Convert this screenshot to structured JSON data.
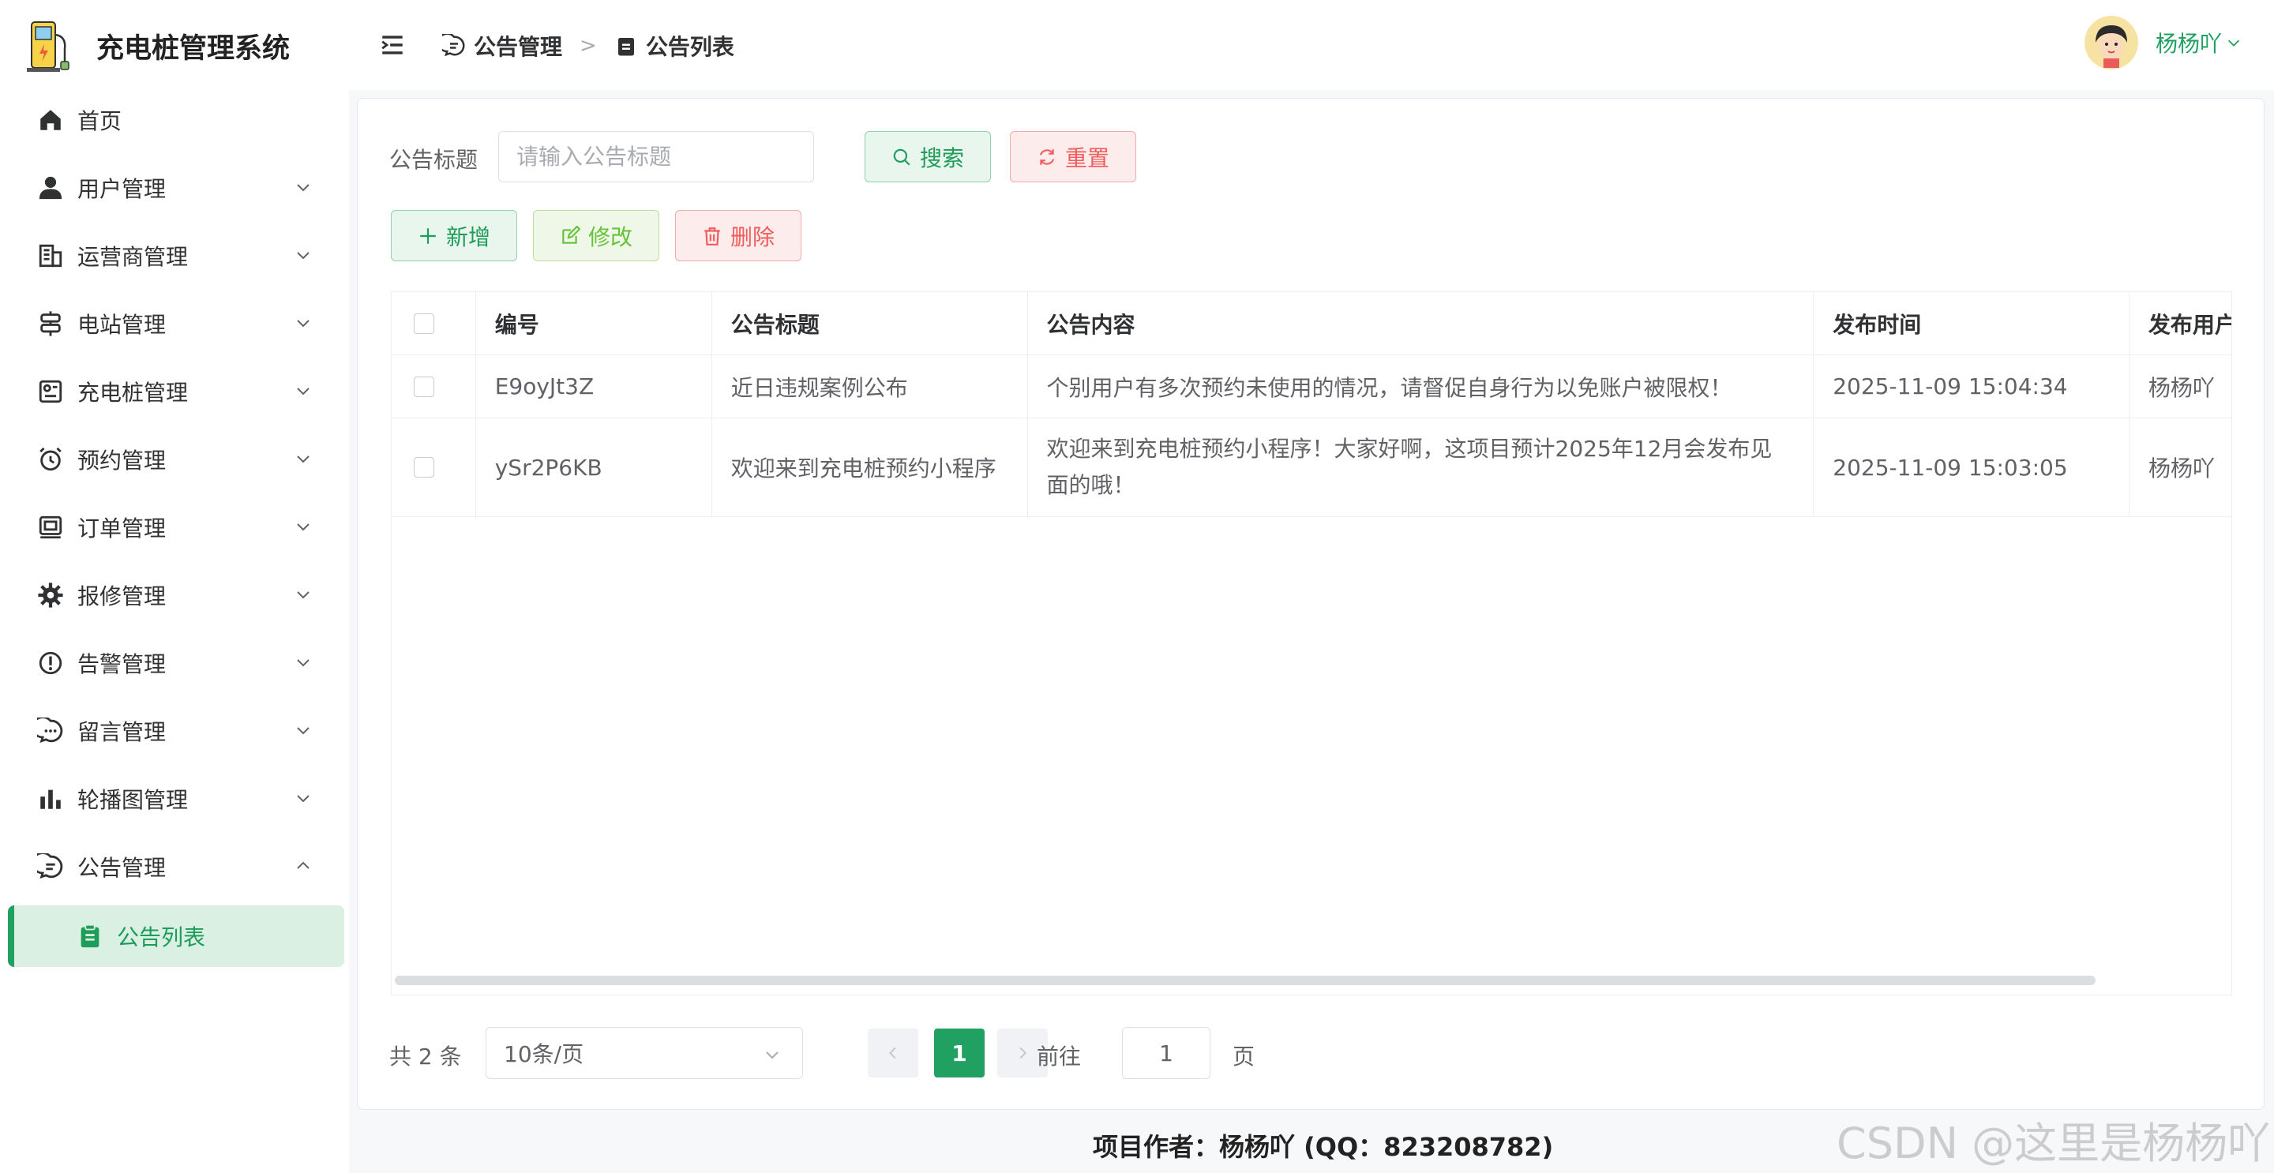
{
  "app": {
    "title": "充电桩管理系统"
  },
  "sidebar": {
    "items": [
      {
        "label": "首页",
        "icon": "home-icon"
      },
      {
        "label": "用户管理",
        "icon": "user-icon"
      },
      {
        "label": "运营商管理",
        "icon": "building-icon"
      },
      {
        "label": "电站管理",
        "icon": "station-icon"
      },
      {
        "label": "充电桩管理",
        "icon": "charger-icon"
      },
      {
        "label": "预约管理",
        "icon": "alarm-clock-icon"
      },
      {
        "label": "订单管理",
        "icon": "order-icon"
      },
      {
        "label": "报修管理",
        "icon": "gear-icon"
      },
      {
        "label": "告警管理",
        "icon": "warning-icon"
      },
      {
        "label": "留言管理",
        "icon": "chat-dots-icon"
      },
      {
        "label": "轮播图管理",
        "icon": "bar-chart-icon"
      },
      {
        "label": "公告管理",
        "icon": "chat-line-icon"
      }
    ],
    "sub_item": {
      "label": "公告列表",
      "icon": "clipboard-icon"
    }
  },
  "header": {
    "breadcrumb": [
      "公告管理",
      "公告列表"
    ],
    "user": "杨杨吖"
  },
  "search": {
    "label": "公告标题",
    "placeholder": "请输入公告标题",
    "search_btn": "搜索",
    "reset_btn": "重置"
  },
  "toolbar": {
    "add": "新增",
    "edit": "修改",
    "delete": "删除"
  },
  "table": {
    "columns": [
      "编号",
      "公告标题",
      "公告内容",
      "发布时间",
      "发布用户"
    ],
    "rows": [
      [
        "E9oyJt3Z",
        "近日违规案例公布",
        "个别用户有多次预约未使用的情况，请督促自身行为以免账户被限权！",
        "2025-11-09 15:04:34",
        "杨杨吖"
      ],
      [
        "ySr2P6KB",
        "欢迎来到充电桩预约小程序",
        "欢迎来到充电桩预约小程序！大家好啊，这项目预计2025年12月会发布见面的哦！",
        "2025-11-09 15:03:05",
        "杨杨吖"
      ]
    ]
  },
  "pager": {
    "total": "共 2 条",
    "size": "10条/页",
    "current": "1",
    "goto": "前往",
    "goto_value": "1",
    "page": "页"
  },
  "footer": "项目作者：杨杨吖 (QQ：823208782)",
  "watermark": "CSDN @这里是杨杨吖",
  "colors": {
    "accent": "#20a162",
    "danger": "#f15b5b",
    "warning": "#67c23a"
  }
}
